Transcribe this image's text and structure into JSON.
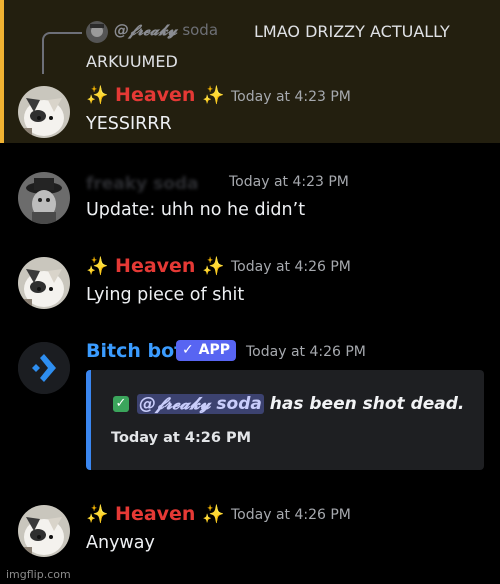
{
  "reply": {
    "mention": "@𝓯𝓻𝓮𝓪𝓴𝔂",
    "name_suffix": "soda",
    "text_line1": "LMAO DRIZZY ACTUALLY",
    "text_line2": "ARKUUMED"
  },
  "messages": [
    {
      "sparkle_left": "✨",
      "author": "Heaven",
      "sparkle_right": "✨",
      "time": "Today at 4:23 PM",
      "text": "YESSIRRR"
    },
    {
      "author": "freaky soda",
      "time": "Today at 4:23 PM",
      "text": "Update: uhh no he didn’t"
    },
    {
      "sparkle_left": "✨",
      "author": "Heaven",
      "sparkle_right": "✨",
      "time": "Today at 4:26 PM",
      "text": "Lying piece of shit"
    },
    {
      "author": "Bitch bot",
      "badge": "✓ APP",
      "time": "Today at 4:26 PM",
      "embed": {
        "check": "✓",
        "mention": "@𝓯𝓻𝓮𝓪𝓴𝔂 soda",
        "text": "has been shot dead.",
        "time": "Today at 4:26 PM"
      }
    },
    {
      "sparkle_left": "✨",
      "author": "Heaven",
      "sparkle_right": "✨",
      "time": "Today at 4:26 PM",
      "text": "Anyway"
    }
  ],
  "watermark": "imgflip.com",
  "colors": {
    "highlight_bar": "#f0b232",
    "heaven": "#e53935",
    "bot": "#3b9cff",
    "app_badge": "#5865f2"
  }
}
